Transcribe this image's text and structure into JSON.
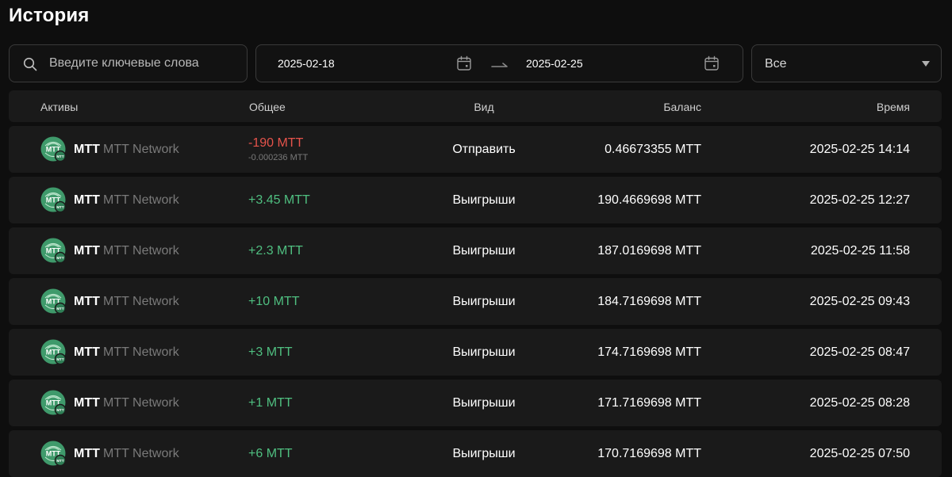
{
  "page": {
    "title": "История"
  },
  "filters": {
    "search_placeholder": "Введите ключевые слова",
    "date_from": "2025-02-18",
    "date_to": "2025-02-25",
    "type_selected": "Все"
  },
  "table": {
    "headers": {
      "asset": "Активы",
      "total": "Общее",
      "kind": "Вид",
      "balance": "Баланс",
      "time": "Время"
    },
    "rows": [
      {
        "symbol": "MTT",
        "name": "MTT Network",
        "amount": "-190 MTT",
        "amount_sign": "neg",
        "sub": "-0.000236 MTT",
        "kind": "Отправить",
        "balance": "0.46673355 MTT",
        "time": "2025-02-25 14:14"
      },
      {
        "symbol": "MTT",
        "name": "MTT Network",
        "amount": "+3.45 MTT",
        "amount_sign": "pos",
        "kind": "Выигрыши",
        "balance": "190.4669698 MTT",
        "time": "2025-02-25 12:27"
      },
      {
        "symbol": "MTT",
        "name": "MTT Network",
        "amount": "+2.3 MTT",
        "amount_sign": "pos",
        "kind": "Выигрыши",
        "balance": "187.0169698 MTT",
        "time": "2025-02-25 11:58"
      },
      {
        "symbol": "MTT",
        "name": "MTT Network",
        "amount": "+10 MTT",
        "amount_sign": "pos",
        "kind": "Выигрыши",
        "balance": "184.7169698 MTT",
        "time": "2025-02-25 09:43"
      },
      {
        "symbol": "MTT",
        "name": "MTT Network",
        "amount": "+3 MTT",
        "amount_sign": "pos",
        "kind": "Выигрыши",
        "balance": "174.7169698 MTT",
        "time": "2025-02-25 08:47"
      },
      {
        "symbol": "MTT",
        "name": "MTT Network",
        "amount": "+1 MTT",
        "amount_sign": "pos",
        "kind": "Выигрыши",
        "balance": "171.7169698 MTT",
        "time": "2025-02-25 08:28"
      },
      {
        "symbol": "MTT",
        "name": "MTT Network",
        "amount": "+6 MTT",
        "amount_sign": "pos",
        "kind": "Выигрыши",
        "balance": "170.7169698 MTT",
        "time": "2025-02-25 07:50"
      }
    ]
  },
  "icons": {
    "search": "search-icon",
    "calendar": "calendar-icon",
    "range_arrow": "arrow-right-icon",
    "dropdown": "caret-down-icon",
    "asset_logo": "mtt-logo-icon"
  },
  "colors": {
    "negative": "#e5534b",
    "positive": "#4fbf80",
    "logo": "#3f9a6b"
  }
}
